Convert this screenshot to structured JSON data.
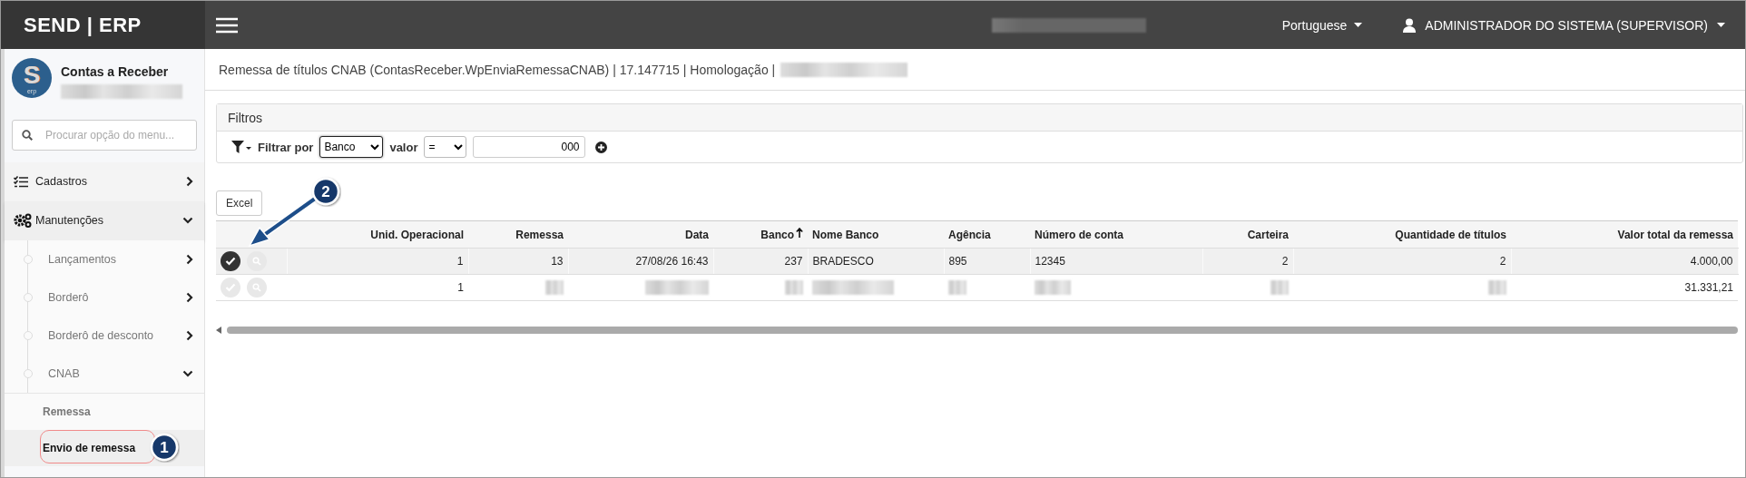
{
  "app": {
    "title": "SEND | ERP"
  },
  "header": {
    "language": "Portuguese",
    "user": "ADMINISTRADOR DO SISTEMA (SUPERVISOR)"
  },
  "sidebar": {
    "logo": {
      "mark": "S",
      "caption": "erp"
    },
    "module": "Contas a Receber",
    "search": {
      "placeholder": "Procurar opção do menu..."
    },
    "menu": [
      {
        "label": "Cadastros",
        "expanded": false
      },
      {
        "label": "Manutenções",
        "expanded": true,
        "children": [
          {
            "label": "Lançamentos",
            "expanded": false
          },
          {
            "label": "Borderô",
            "expanded": false
          },
          {
            "label": "Borderô de desconto",
            "expanded": false
          },
          {
            "label": "CNAB",
            "expanded": true,
            "children": [
              {
                "label": "Remessa",
                "selected": false
              },
              {
                "label": "Envio de remessa",
                "selected": true
              }
            ]
          }
        ]
      }
    ]
  },
  "page": {
    "breadcrumb": "Remessa de títulos CNAB (ContasReceber.WpEnviaRemessaCNAB) | 17.147715 | Homologação |",
    "filters": {
      "title": "Filtros",
      "label": "Filtrar por",
      "field": "Banco",
      "value_label": "valor",
      "operator": "=",
      "value": "000"
    },
    "export_button": "Excel",
    "table": {
      "columns": [
        {
          "label": "Unid. Operacional",
          "kind": "number",
          "sorted": false
        },
        {
          "label": "Remessa",
          "kind": "number",
          "sorted": false
        },
        {
          "label": "Data",
          "kind": "number",
          "sorted": false
        },
        {
          "label": "Banco",
          "kind": "number",
          "sorted": true
        },
        {
          "label": "Nome Banco",
          "kind": "text",
          "sorted": false
        },
        {
          "label": "Agência",
          "kind": "text",
          "sorted": false
        },
        {
          "label": "Número de conta",
          "kind": "text",
          "sorted": false
        },
        {
          "label": "Carteira",
          "kind": "number",
          "sorted": false
        },
        {
          "label": "Quantidade de títulos",
          "kind": "number",
          "sorted": false
        },
        {
          "label": "Valor total da remessa",
          "kind": "number",
          "sorted": false
        }
      ],
      "rows": [
        {
          "selected": true,
          "cells": [
            "1",
            "13",
            "27/08/26 16:43",
            "237",
            "BRADESCO",
            "895",
            "12345",
            "2",
            "2",
            "4.000,00"
          ]
        },
        {
          "selected": false,
          "cells": [
            "1",
            null,
            null,
            null,
            null,
            null,
            null,
            null,
            null,
            "31.331,21"
          ]
        }
      ]
    }
  },
  "annotations": [
    {
      "label": "1"
    },
    {
      "label": "2"
    }
  ]
}
